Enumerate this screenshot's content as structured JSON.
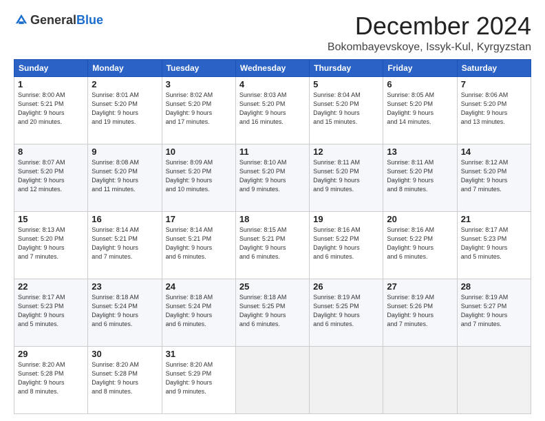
{
  "header": {
    "logo_general": "General",
    "logo_blue": "Blue",
    "month_title": "December 2024",
    "location": "Bokombayevskoye, Issyk-Kul, Kyrgyzstan"
  },
  "weekdays": [
    "Sunday",
    "Monday",
    "Tuesday",
    "Wednesday",
    "Thursday",
    "Friday",
    "Saturday"
  ],
  "weeks": [
    [
      {
        "day": "1",
        "info": "Sunrise: 8:00 AM\nSunset: 5:21 PM\nDaylight: 9 hours\nand 20 minutes."
      },
      {
        "day": "2",
        "info": "Sunrise: 8:01 AM\nSunset: 5:20 PM\nDaylight: 9 hours\nand 19 minutes."
      },
      {
        "day": "3",
        "info": "Sunrise: 8:02 AM\nSunset: 5:20 PM\nDaylight: 9 hours\nand 17 minutes."
      },
      {
        "day": "4",
        "info": "Sunrise: 8:03 AM\nSunset: 5:20 PM\nDaylight: 9 hours\nand 16 minutes."
      },
      {
        "day": "5",
        "info": "Sunrise: 8:04 AM\nSunset: 5:20 PM\nDaylight: 9 hours\nand 15 minutes."
      },
      {
        "day": "6",
        "info": "Sunrise: 8:05 AM\nSunset: 5:20 PM\nDaylight: 9 hours\nand 14 minutes."
      },
      {
        "day": "7",
        "info": "Sunrise: 8:06 AM\nSunset: 5:20 PM\nDaylight: 9 hours\nand 13 minutes."
      }
    ],
    [
      {
        "day": "8",
        "info": "Sunrise: 8:07 AM\nSunset: 5:20 PM\nDaylight: 9 hours\nand 12 minutes."
      },
      {
        "day": "9",
        "info": "Sunrise: 8:08 AM\nSunset: 5:20 PM\nDaylight: 9 hours\nand 11 minutes."
      },
      {
        "day": "10",
        "info": "Sunrise: 8:09 AM\nSunset: 5:20 PM\nDaylight: 9 hours\nand 10 minutes."
      },
      {
        "day": "11",
        "info": "Sunrise: 8:10 AM\nSunset: 5:20 PM\nDaylight: 9 hours\nand 9 minutes."
      },
      {
        "day": "12",
        "info": "Sunrise: 8:11 AM\nSunset: 5:20 PM\nDaylight: 9 hours\nand 9 minutes."
      },
      {
        "day": "13",
        "info": "Sunrise: 8:11 AM\nSunset: 5:20 PM\nDaylight: 9 hours\nand 8 minutes."
      },
      {
        "day": "14",
        "info": "Sunrise: 8:12 AM\nSunset: 5:20 PM\nDaylight: 9 hours\nand 7 minutes."
      }
    ],
    [
      {
        "day": "15",
        "info": "Sunrise: 8:13 AM\nSunset: 5:20 PM\nDaylight: 9 hours\nand 7 minutes."
      },
      {
        "day": "16",
        "info": "Sunrise: 8:14 AM\nSunset: 5:21 PM\nDaylight: 9 hours\nand 7 minutes."
      },
      {
        "day": "17",
        "info": "Sunrise: 8:14 AM\nSunset: 5:21 PM\nDaylight: 9 hours\nand 6 minutes."
      },
      {
        "day": "18",
        "info": "Sunrise: 8:15 AM\nSunset: 5:21 PM\nDaylight: 9 hours\nand 6 minutes."
      },
      {
        "day": "19",
        "info": "Sunrise: 8:16 AM\nSunset: 5:22 PM\nDaylight: 9 hours\nand 6 minutes."
      },
      {
        "day": "20",
        "info": "Sunrise: 8:16 AM\nSunset: 5:22 PM\nDaylight: 9 hours\nand 6 minutes."
      },
      {
        "day": "21",
        "info": "Sunrise: 8:17 AM\nSunset: 5:23 PM\nDaylight: 9 hours\nand 5 minutes."
      }
    ],
    [
      {
        "day": "22",
        "info": "Sunrise: 8:17 AM\nSunset: 5:23 PM\nDaylight: 9 hours\nand 5 minutes."
      },
      {
        "day": "23",
        "info": "Sunrise: 8:18 AM\nSunset: 5:24 PM\nDaylight: 9 hours\nand 6 minutes."
      },
      {
        "day": "24",
        "info": "Sunrise: 8:18 AM\nSunset: 5:24 PM\nDaylight: 9 hours\nand 6 minutes."
      },
      {
        "day": "25",
        "info": "Sunrise: 8:18 AM\nSunset: 5:25 PM\nDaylight: 9 hours\nand 6 minutes."
      },
      {
        "day": "26",
        "info": "Sunrise: 8:19 AM\nSunset: 5:25 PM\nDaylight: 9 hours\nand 6 minutes."
      },
      {
        "day": "27",
        "info": "Sunrise: 8:19 AM\nSunset: 5:26 PM\nDaylight: 9 hours\nand 7 minutes."
      },
      {
        "day": "28",
        "info": "Sunrise: 8:19 AM\nSunset: 5:27 PM\nDaylight: 9 hours\nand 7 minutes."
      }
    ],
    [
      {
        "day": "29",
        "info": "Sunrise: 8:20 AM\nSunset: 5:28 PM\nDaylight: 9 hours\nand 8 minutes."
      },
      {
        "day": "30",
        "info": "Sunrise: 8:20 AM\nSunset: 5:28 PM\nDaylight: 9 hours\nand 8 minutes."
      },
      {
        "day": "31",
        "info": "Sunrise: 8:20 AM\nSunset: 5:29 PM\nDaylight: 9 hours\nand 9 minutes."
      },
      {
        "day": "",
        "info": ""
      },
      {
        "day": "",
        "info": ""
      },
      {
        "day": "",
        "info": ""
      },
      {
        "day": "",
        "info": ""
      }
    ]
  ]
}
